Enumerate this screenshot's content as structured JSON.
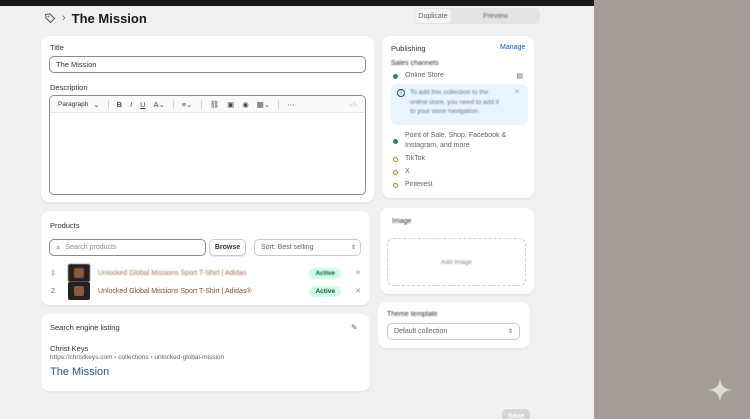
{
  "header": {
    "title": "The Mission",
    "actions": [
      "Duplicate",
      "Preview"
    ]
  },
  "title_section": {
    "label": "Title",
    "value": "The Mission"
  },
  "description": {
    "label": "Description",
    "toolbar_format": "Paragraph"
  },
  "publishing": {
    "heading": "Publishing",
    "manage": "Manage",
    "sales_channels_label": "Sales channels",
    "online_store": "Online Store",
    "info_text": "To add this collection to the online store, you need to add it to your store navigation.",
    "channels": [
      {
        "name": "Point of Sale, Shop, Facebook & Instagram, and more",
        "status": "active"
      },
      {
        "name": "TikTok",
        "status": "inactive"
      },
      {
        "name": "X",
        "status": "inactive"
      },
      {
        "name": "Pinterest",
        "status": "inactive"
      }
    ]
  },
  "image_card": {
    "label": "Image",
    "drop_text": "Add image"
  },
  "theme_template": {
    "label": "Theme template",
    "value": "Default collection"
  },
  "products": {
    "heading": "Products",
    "search_placeholder": "Search products",
    "browse_label": "Browse",
    "sort_label": "Sort: Best selling",
    "rows": [
      {
        "num": "1.",
        "name": "Unlocked Global Missions Sport T-Shirt | Adidas",
        "status": "Active"
      },
      {
        "num": "2.",
        "name": "Unlocked Global Missions Sport T-Shirt | Adidas®",
        "status": "Active"
      }
    ]
  },
  "seo": {
    "heading": "Search engine listing",
    "store_name": "Christ Keys",
    "url": "https://christkeys.com › collections › unlocked-global-mission",
    "title": "The Mission"
  },
  "footer": {
    "save_label": "Save"
  },
  "colors": {
    "accent": "#005bd3",
    "active_badge_bg": "#cdfee1",
    "active_dot": "#29845a",
    "inactive_dot": "#b98900",
    "seo_link": "#1f5199"
  }
}
